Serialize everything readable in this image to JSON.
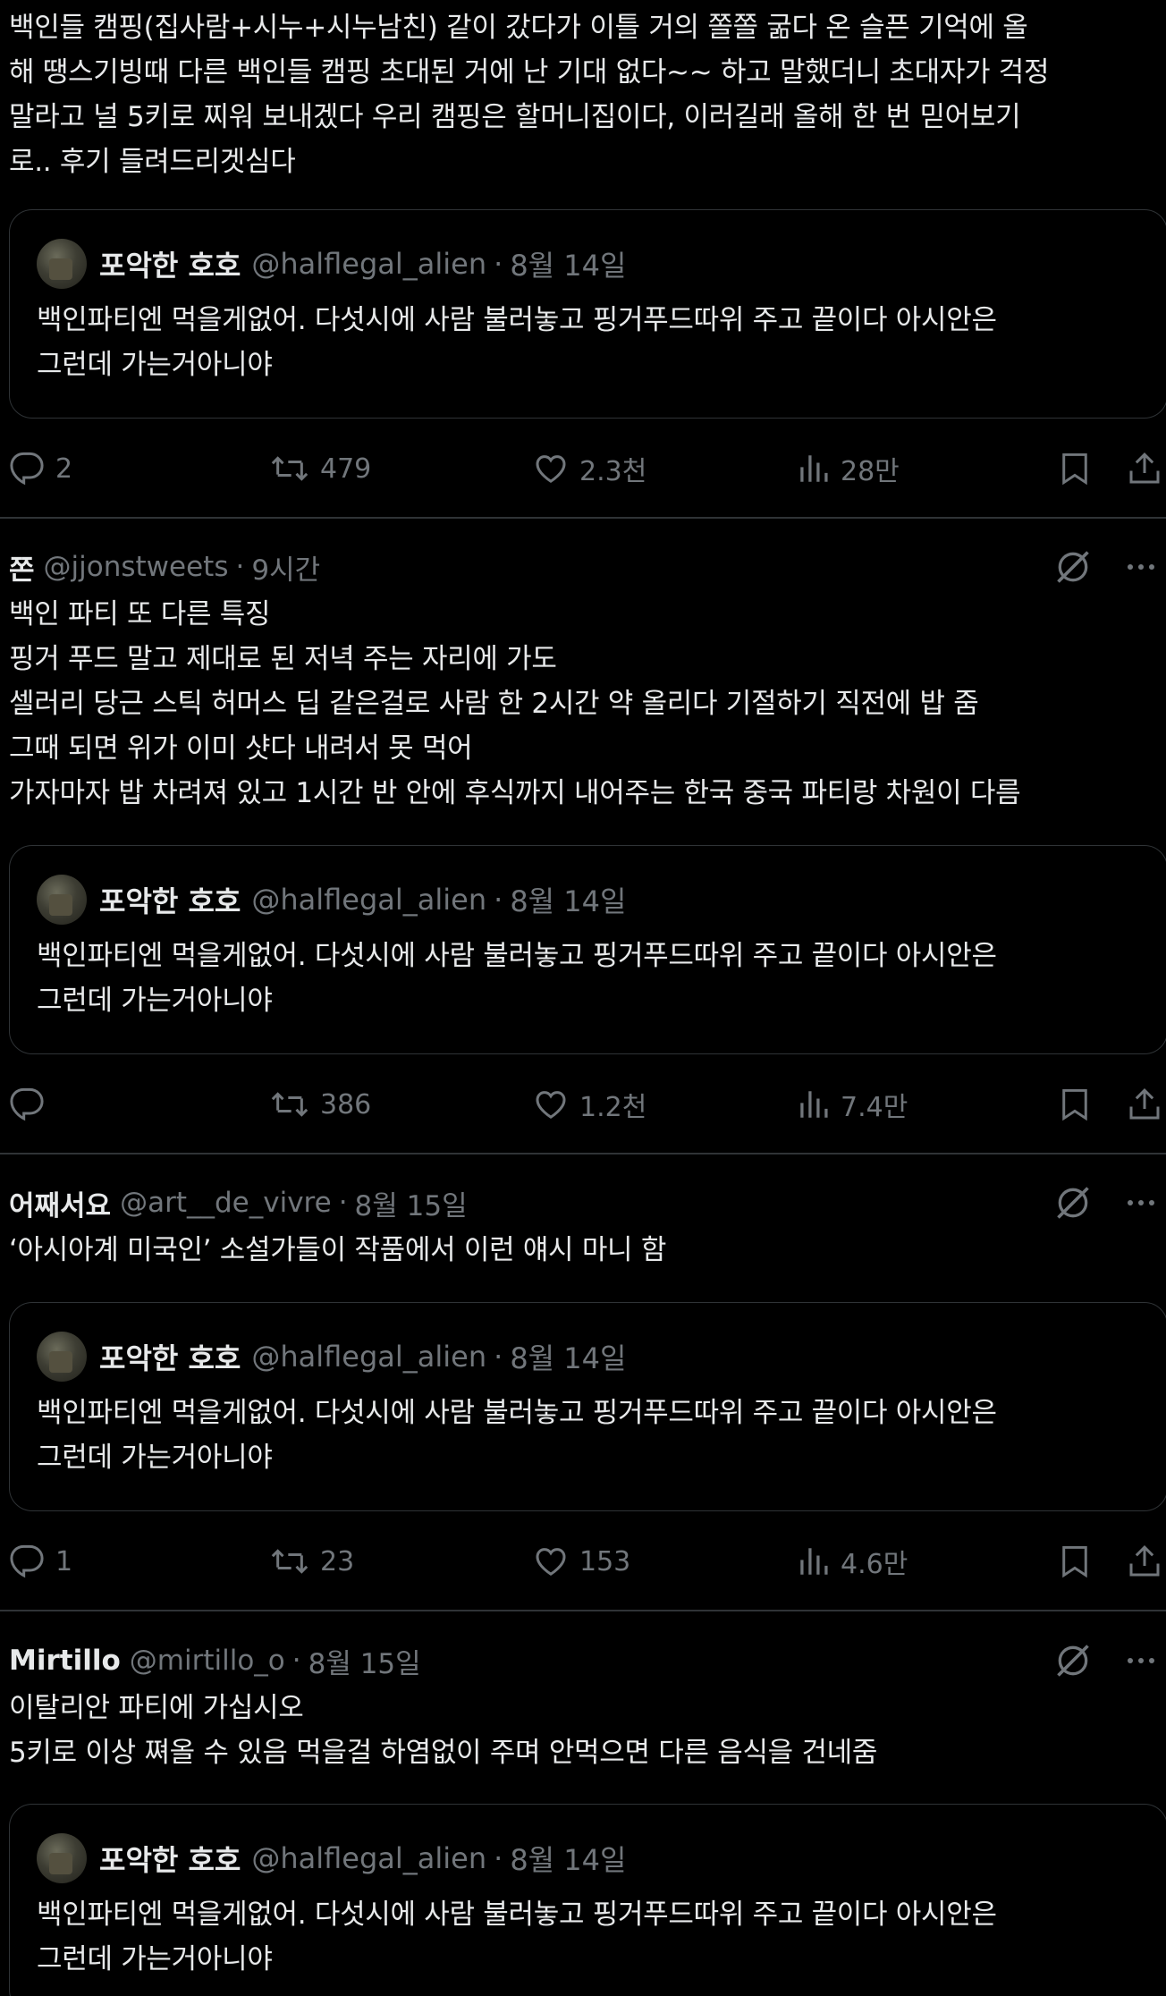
{
  "icons": [
    "reply-icon",
    "retweet-icon",
    "like-icon",
    "views-icon",
    "bookmark-icon",
    "share-icon",
    "grok-icon",
    "more-icon"
  ],
  "colors": {
    "background": "#000000",
    "text": "#e7e9ea",
    "muted": "#71767b",
    "border": "#2f3336"
  },
  "quoted": {
    "name": "포악한 호호",
    "handle": "@halflegal_alien",
    "time": "8월 14일",
    "text": "백인파티엔 먹을게없어. 다섯시에 사람 불러놓고 핑거푸드따위 주고 끝이다 아시안은\n그런데 가는거아니야"
  },
  "posts": [
    {
      "text": "백인들 캠핑(집사람+시누+시누남친) 같이 갔다가 이틀 거의 쫄쫄 굶다 온 슬픈 기억에 올\n해 땡스기빙때 다른 백인들 캠핑 초대된 거에 난 기대 없다~~ 하고 말했더니 초대자가 걱정\n말라고 널 5키로 찌워 보내겠다 우리 캠핑은 할머니집이다, 이러길래 올해 한 번 믿어보기\n로.. 후기 들려드리겟심다",
      "stats": {
        "replies": "2",
        "reposts": "479",
        "likes": "2.3천",
        "views": "28만"
      }
    },
    {
      "name": "쫀",
      "handle": "@jjonstweets",
      "time": "9시간",
      "text": "백인 파티 또 다른 특징\n핑거 푸드 말고 제대로 된 저녁 주는 자리에 가도\n셀러리 당근 스틱 허머스 딥 같은걸로 사람 한 2시간 약 올리다 기절하기 직전에 밥 줌\n그때 되면 위가 이미 샷다 내려서 못 먹어\n가자마자 밥 차려져 있고 1시간 반 안에 후식까지 내어주는 한국 중국 파티랑 차원이 다름",
      "stats": {
        "replies": "",
        "reposts": "386",
        "likes": "1.2천",
        "views": "7.4만"
      }
    },
    {
      "name": "어째서요",
      "handle": "@art__de_vivre",
      "time": "8월 15일",
      "text": "‘아시아계 미국인’ 소설가들이 작품에서 이런 얘시 마니 함",
      "stats": {
        "replies": "1",
        "reposts": "23",
        "likes": "153",
        "views": "4.6만"
      }
    },
    {
      "name": "Mirtillo",
      "handle": "@mirtillo_o",
      "time": "8월 15일",
      "text": "이탈리안 파티에 가십시오\n5키로 이상 쪄올 수 있음 먹을걸 하염없이 주며 안먹으면 다른 음식을 건네줌"
    }
  ]
}
